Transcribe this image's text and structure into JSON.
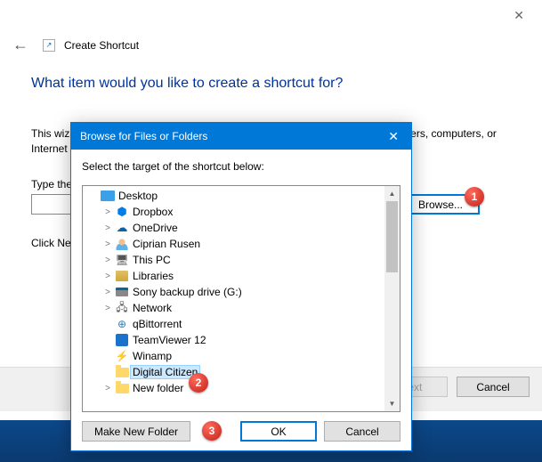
{
  "wizard": {
    "title": "Create Shortcut",
    "heading": "What item would you like to create a shortcut for?",
    "description": "This wizard helps you to create shortcuts to local or network programs, files, folders, computers, or Internet addresses.",
    "input_label": "Type the location of the item:",
    "input_value": "",
    "browse_label": "Browse...",
    "clicknext": "Click Next to continue.",
    "next_label": "Next",
    "cancel_label": "Cancel"
  },
  "dialog": {
    "title": "Browse for Files or Folders",
    "instruction": "Select the target of the shortcut below:",
    "tree": [
      {
        "indent": 0,
        "expander": "",
        "icon": "desktop",
        "label": "Desktop"
      },
      {
        "indent": 1,
        "expander": ">",
        "icon": "dropbox",
        "label": "Dropbox"
      },
      {
        "indent": 1,
        "expander": ">",
        "icon": "onedrive",
        "label": "OneDrive"
      },
      {
        "indent": 1,
        "expander": ">",
        "icon": "user",
        "label": "Ciprian Rusen"
      },
      {
        "indent": 1,
        "expander": ">",
        "icon": "pc",
        "label": "This PC"
      },
      {
        "indent": 1,
        "expander": ">",
        "icon": "lib",
        "label": "Libraries"
      },
      {
        "indent": 1,
        "expander": ">",
        "icon": "drive",
        "label": "Sony backup drive (G:)"
      },
      {
        "indent": 1,
        "expander": ">",
        "icon": "net",
        "label": "Network"
      },
      {
        "indent": 1,
        "expander": "",
        "icon": "qb",
        "label": "qBittorrent"
      },
      {
        "indent": 1,
        "expander": "",
        "icon": "tv",
        "label": "TeamViewer 12"
      },
      {
        "indent": 1,
        "expander": "",
        "icon": "winamp",
        "label": "Winamp"
      },
      {
        "indent": 1,
        "expander": "",
        "icon": "folder",
        "label": "Digital Citizen",
        "selected": true
      },
      {
        "indent": 1,
        "expander": ">",
        "icon": "folder",
        "label": "New folder",
        "faded": true
      }
    ],
    "make_folder_label": "Make New Folder",
    "ok_label": "OK",
    "cancel_label": "Cancel"
  },
  "annotations": {
    "a1": "1",
    "a2": "2",
    "a3": "3"
  },
  "icons": {
    "dropbox": "⬢",
    "onedrive": "☁",
    "pc": "🖥",
    "net": "🖧",
    "qb": "⊕",
    "winamp": "⚡"
  }
}
